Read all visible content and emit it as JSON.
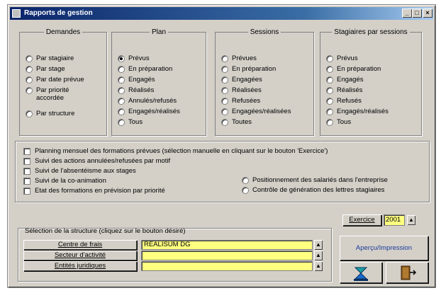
{
  "window": {
    "title": "Rapports de gestion",
    "btn_min": "_",
    "btn_max": "□",
    "btn_close": "×"
  },
  "groups": {
    "demandes": {
      "legend": "Demandes",
      "items": [
        {
          "label": "Par stagiaire",
          "selected": false
        },
        {
          "label": "Par stage",
          "selected": false
        },
        {
          "label": "Par date prévue",
          "selected": false
        },
        {
          "label": "Par priorité accordée",
          "selected": false
        },
        {
          "label": "Par structure",
          "selected": false
        }
      ]
    },
    "plan": {
      "legend": "Plan",
      "items": [
        {
          "label": "Prévus",
          "selected": true
        },
        {
          "label": "En préparation",
          "selected": false
        },
        {
          "label": "Engagés",
          "selected": false
        },
        {
          "label": "Réalisés",
          "selected": false
        },
        {
          "label": "Annulés/refusés",
          "selected": false
        },
        {
          "label": "Engagés/réalisés",
          "selected": false
        },
        {
          "label": "Tous",
          "selected": false
        }
      ]
    },
    "sessions": {
      "legend": "Sessions",
      "items": [
        {
          "label": "Prévues",
          "selected": false
        },
        {
          "label": "En préparation",
          "selected": false
        },
        {
          "label": "Engagées",
          "selected": false
        },
        {
          "label": "Réalisées",
          "selected": false
        },
        {
          "label": "Refusées",
          "selected": false
        },
        {
          "label": "Engagées/réalisées",
          "selected": false
        },
        {
          "label": "Toutes",
          "selected": false
        }
      ]
    },
    "stagiaires": {
      "legend": "Stagiaires par sessions",
      "items": [
        {
          "label": "Prévus",
          "selected": false
        },
        {
          "label": "En préparation",
          "selected": false
        },
        {
          "label": "Engagés",
          "selected": false
        },
        {
          "label": "Réalisés",
          "selected": false
        },
        {
          "label": "Refusés",
          "selected": false
        },
        {
          "label": "Engagés/réalisés",
          "selected": false
        },
        {
          "label": "Tous",
          "selected": false
        }
      ]
    }
  },
  "checks": [
    "Planning mensuel des formations prévues (sélection manuelle en cliquant sur le bouton 'Exercice')",
    "Suivi des actions annulées/refusées par motif",
    "Suivi de l'absentéisme aux stages",
    "Suivi de la co-animation",
    "Etat des formations en prévision par priorité"
  ],
  "extra_radios": [
    "Positionnement des salariés dans l'entreprise",
    "Contrôle de génération des lettres stagiaires"
  ],
  "exercice": {
    "button_label": "Exercice",
    "value": "2001",
    "spin": "▲"
  },
  "structure": {
    "caption": "Sélection de la structure (cliquez sur le bouton désiré)",
    "rows": [
      {
        "button": "Centre de frais",
        "value": "REALISUM DG"
      },
      {
        "button": "Secteur d'activité",
        "value": ""
      },
      {
        "button": "Entités juridiques",
        "value": ""
      }
    ],
    "spin": "▲"
  },
  "actions": {
    "preview_label": "Aperçu/Impression",
    "tool_icon": "run-report-icon",
    "exit_icon": "exit-door-icon"
  }
}
